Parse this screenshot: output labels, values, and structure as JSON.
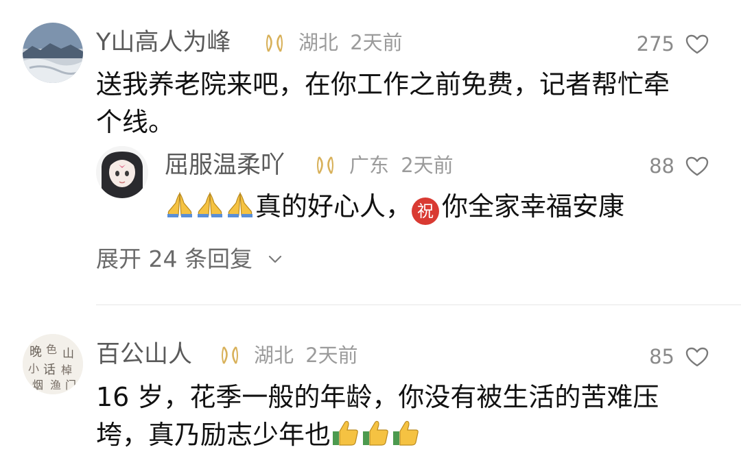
{
  "comments": [
    {
      "avatar": "mountain-snow-avatar",
      "name": "Y山高人为峰",
      "badge": "pass-badge-icon",
      "location": "湖北",
      "time": "2天前",
      "likes": "275",
      "text_line1": "送我养老院来吧，在你工作之前免费，记者帮忙牵",
      "text_line2": "个线。",
      "reply": {
        "avatar": "anime-girl-avatar",
        "name": "屈服温柔吖",
        "badge": "pass-badge-icon",
        "location": "广东",
        "time": "2天前",
        "likes": "88",
        "text_part1": "真的好心人，",
        "text_part2": "你全家幸福安康",
        "prayer_emojis": [
          "folded-hands-icon",
          "folded-hands-icon",
          "folded-hands-icon"
        ],
        "bless_emoji": "blessing-seal-icon",
        "bless_char": "祝"
      },
      "expand_label": "展开 24 条回复"
    },
    {
      "avatar": "calligraphy-avatar",
      "name": "百公山人",
      "badge": "pass-badge-icon",
      "location": "湖北",
      "time": "2天前",
      "likes": "85",
      "text_line1": "16 岁，花季一般的年龄，你没有被生活的苦难压",
      "text_line2": "垮，真乃励志少年也",
      "thumb_emojis": [
        "thumbs-up-icon",
        "thumbs-up-icon",
        "thumbs-up-icon"
      ]
    }
  ],
  "colors": {
    "name": "#5a5a5a",
    "meta": "#9b9b9b",
    "badge": "#d8b15a",
    "bless_red": "#d93a32",
    "text": "#111111"
  }
}
